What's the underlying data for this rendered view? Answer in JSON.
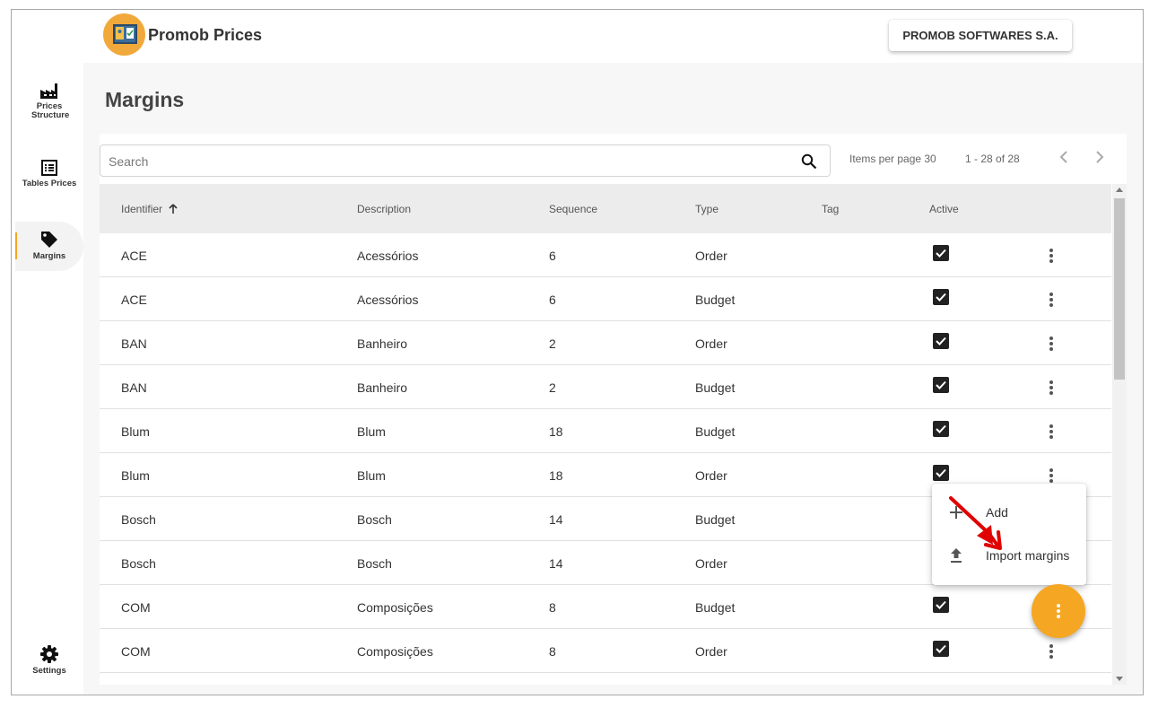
{
  "app": {
    "title": "Promob Prices",
    "company": "PROMOB SOFTWARES S.A."
  },
  "sidebar": {
    "items": [
      {
        "label": "Prices Structure",
        "icon": "factory-icon"
      },
      {
        "label": "Tables Prices",
        "icon": "list-icon"
      },
      {
        "label": "Margins",
        "icon": "tag-icon",
        "active": true
      }
    ],
    "settings": {
      "label": "Settings",
      "icon": "gear-icon"
    }
  },
  "page": {
    "title": "Margins"
  },
  "search": {
    "placeholder": "Search"
  },
  "pagination": {
    "items_per_page": "Items per page 30",
    "range": "1 - 28 of 28"
  },
  "table": {
    "columns": [
      "Identifier",
      "Description",
      "Sequence",
      "Type",
      "Tag",
      "Active"
    ],
    "rows": [
      {
        "identifier": "ACE",
        "description": "Acessórios",
        "sequence": "6",
        "type": "Order",
        "tag": "",
        "active": true
      },
      {
        "identifier": "ACE",
        "description": "Acessórios",
        "sequence": "6",
        "type": "Budget",
        "tag": "",
        "active": true
      },
      {
        "identifier": "BAN",
        "description": "Banheiro",
        "sequence": "2",
        "type": "Order",
        "tag": "",
        "active": true
      },
      {
        "identifier": "BAN",
        "description": "Banheiro",
        "sequence": "2",
        "type": "Budget",
        "tag": "",
        "active": true
      },
      {
        "identifier": "Blum",
        "description": "Blum",
        "sequence": "18",
        "type": "Budget",
        "tag": "",
        "active": true
      },
      {
        "identifier": "Blum",
        "description": "Blum",
        "sequence": "18",
        "type": "Order",
        "tag": "",
        "active": true
      },
      {
        "identifier": "Bosch",
        "description": "Bosch",
        "sequence": "14",
        "type": "Budget",
        "tag": "",
        "active": true
      },
      {
        "identifier": "Bosch",
        "description": "Bosch",
        "sequence": "14",
        "type": "Order",
        "tag": "",
        "active": true
      },
      {
        "identifier": "COM",
        "description": "Composições",
        "sequence": "8",
        "type": "Budget",
        "tag": "",
        "active": true
      },
      {
        "identifier": "COM",
        "description": "Composições",
        "sequence": "8",
        "type": "Order",
        "tag": "",
        "active": true
      }
    ]
  },
  "context_menu": {
    "add_label": "Add",
    "import_label": "Import margins"
  },
  "colors": {
    "accent": "#f5a623",
    "annotation": "#e00000"
  }
}
